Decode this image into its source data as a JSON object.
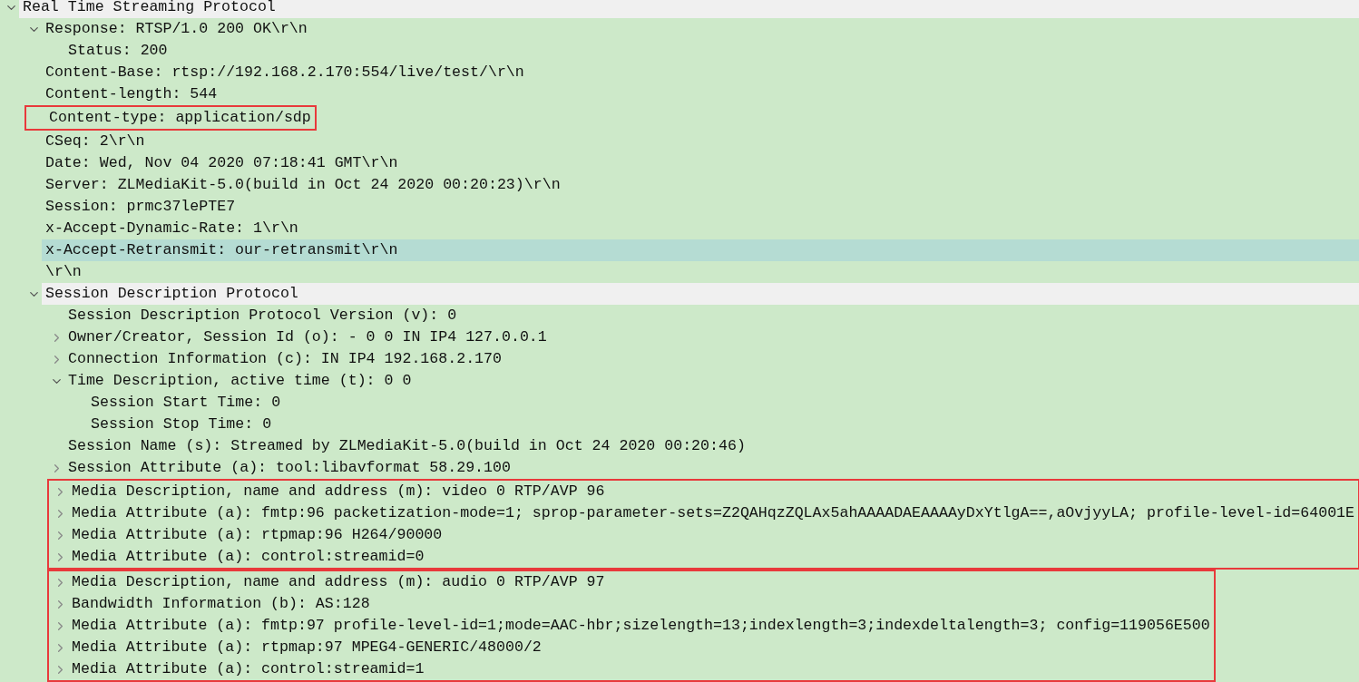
{
  "tree": [
    {
      "kind": "protocol",
      "label": "Real Time Streaming Protocol",
      "expanded": true,
      "selected": false,
      "children": [
        {
          "kind": "field",
          "label": "Response: RTSP/1.0 200 OK\\r\\n",
          "expanded": true,
          "selected": false,
          "children": [
            {
              "kind": "field",
              "label": "Status: 200",
              "selected": false
            }
          ]
        },
        {
          "kind": "field",
          "label": "Content-Base: rtsp://192.168.2.170:554/live/test/\\r\\n",
          "selected": false
        },
        {
          "kind": "field",
          "label": "Content-length: 544",
          "selected": false
        },
        {
          "kind": "outline-box",
          "rows": [
            {
              "kind": "field",
              "label": "Content-type: application/sdp",
              "selected": false
            }
          ]
        },
        {
          "kind": "field",
          "label": "CSeq: 2\\r\\n",
          "selected": false
        },
        {
          "kind": "field",
          "label": "Date: Wed, Nov 04 2020 07:18:41 GMT\\r\\n",
          "selected": false
        },
        {
          "kind": "field",
          "label": "Server: ZLMediaKit-5.0(build in Oct 24 2020 00:20:23)\\r\\n",
          "selected": false
        },
        {
          "kind": "field",
          "label": "Session: prmc37lePTE7",
          "selected": false
        },
        {
          "kind": "field",
          "label": "x-Accept-Dynamic-Rate: 1\\r\\n",
          "selected": false
        },
        {
          "kind": "field",
          "label": "x-Accept-Retransmit: our-retransmit\\r\\n",
          "selected": true
        },
        {
          "kind": "field",
          "label": "\\r\\n",
          "selected": false
        },
        {
          "kind": "protocol",
          "label": "Session Description Protocol",
          "expanded": true,
          "selected": false,
          "children": [
            {
              "kind": "field",
              "label": "Session Description Protocol Version (v): 0",
              "selected": false
            },
            {
              "kind": "field",
              "label": "Owner/Creator, Session Id (o): - 0 0 IN IP4 127.0.0.1",
              "expanded": false,
              "selected": false
            },
            {
              "kind": "field",
              "label": "Connection Information (c): IN IP4 192.168.2.170",
              "expanded": false,
              "selected": false
            },
            {
              "kind": "field",
              "label": "Time Description, active time (t): 0 0",
              "expanded": true,
              "selected": false,
              "children": [
                {
                  "kind": "field",
                  "label": "Session Start Time: 0",
                  "selected": false
                },
                {
                  "kind": "field",
                  "label": "Session Stop Time: 0",
                  "selected": false
                }
              ]
            },
            {
              "kind": "field",
              "label": "Session Name (s): Streamed by ZLMediaKit-5.0(build in Oct 24 2020 00:20:46)",
              "selected": false
            },
            {
              "kind": "field",
              "label": "Session Attribute (a): tool:libavformat 58.29.100",
              "expanded": false,
              "selected": false
            },
            {
              "kind": "outline-box",
              "rows": [
                {
                  "kind": "field",
                  "label": "Media Description, name and address (m): video 0 RTP/AVP 96",
                  "expanded": false,
                  "selected": false
                },
                {
                  "kind": "field",
                  "label": "Media Attribute (a): fmtp:96 packetization-mode=1; sprop-parameter-sets=Z2QAHqzZQLAx5ahAAAADAEAAAAyDxYtlgA==,aOvjyyLA; profile-level-id=64001E",
                  "expanded": false,
                  "selected": false
                },
                {
                  "kind": "field",
                  "label": "Media Attribute (a): rtpmap:96 H264/90000",
                  "expanded": false,
                  "selected": false
                },
                {
                  "kind": "field",
                  "label": "Media Attribute (a): control:streamid=0",
                  "expanded": false,
                  "selected": false
                }
              ]
            },
            {
              "kind": "outline-box",
              "rows": [
                {
                  "kind": "field",
                  "label": "Media Description, name and address (m): audio 0 RTP/AVP 97",
                  "expanded": false,
                  "selected": false
                },
                {
                  "kind": "field",
                  "label": "Bandwidth Information (b): AS:128",
                  "expanded": false,
                  "selected": false
                },
                {
                  "kind": "field",
                  "label": "Media Attribute (a): fmtp:97 profile-level-id=1;mode=AAC-hbr;sizelength=13;indexlength=3;indexdeltalength=3; config=119056E500",
                  "expanded": false,
                  "selected": false
                },
                {
                  "kind": "field",
                  "label": "Media Attribute (a): rtpmap:97 MPEG4-GENERIC/48000/2",
                  "expanded": false,
                  "selected": false
                },
                {
                  "kind": "field",
                  "label": "Media Attribute (a): control:streamid=1",
                  "expanded": false,
                  "selected": false
                }
              ]
            }
          ]
        }
      ]
    }
  ]
}
